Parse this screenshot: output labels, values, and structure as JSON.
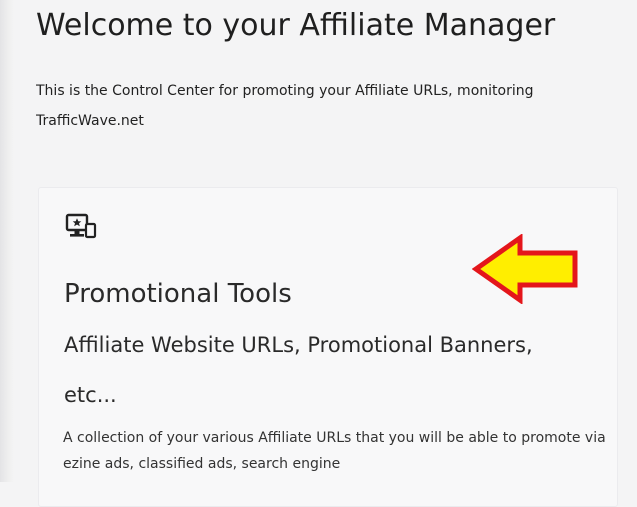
{
  "page": {
    "title": "Welcome to your Affiliate Manager",
    "intro_line1": "This is the Control Center for promoting your Affiliate URLs, monitoring",
    "intro_line2": "TrafficWave.net"
  },
  "card": {
    "icon": "desktop-mobile-star-icon",
    "title": "Promotional Tools",
    "subtitle": "Affiliate Website URLs, Promotional Banners, etc...",
    "description": "A collection of your various Affiliate URLs that you will be able to promote via ezine ads, classified ads, search engine"
  },
  "annotation": {
    "icon": "arrow-left-icon",
    "fill_color": "#ffee00",
    "stroke_color": "#e4161b"
  }
}
